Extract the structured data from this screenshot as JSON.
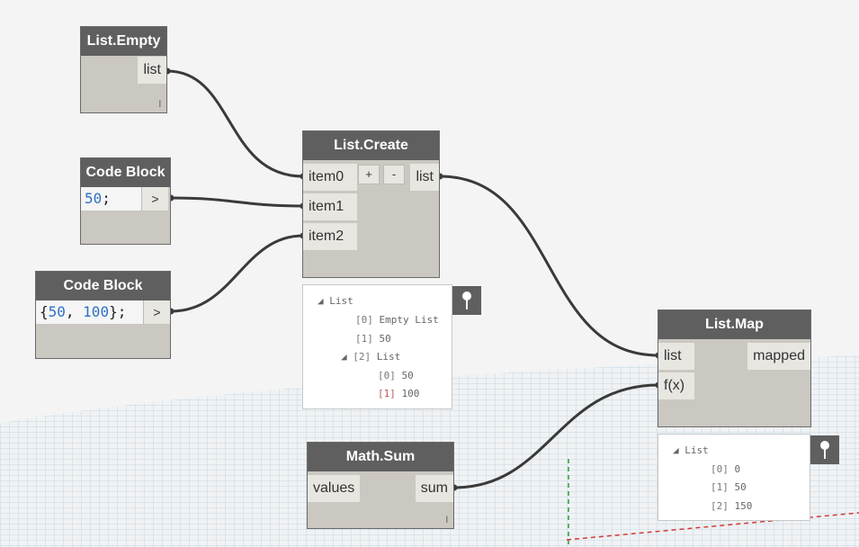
{
  "nodes": {
    "list_empty": {
      "title": "List.Empty",
      "output": "list",
      "lacing": "l"
    },
    "code_block_1": {
      "title": "Code Block",
      "code": "50;",
      "code_num": "50",
      "code_rest": ";",
      "output": ">"
    },
    "code_block_2": {
      "title": "Code Block",
      "code_open": "{",
      "num1": "50",
      "sep": ", ",
      "num2": "100",
      "code_close": "};",
      "output": ">"
    },
    "list_create": {
      "title": "List.Create",
      "inputs": [
        "item0",
        "item1",
        "item2"
      ],
      "add": "+",
      "remove": "-",
      "output": "list"
    },
    "list_map": {
      "title": "List.Map",
      "inputs": [
        "list",
        "f(x)"
      ],
      "output": "mapped"
    },
    "math_sum": {
      "title": "Math.Sum",
      "input": "values",
      "output": "sum",
      "lacing": "l"
    }
  },
  "previews": {
    "list_create": {
      "root": "List",
      "items": [
        {
          "index": "[0]",
          "value": "Empty List"
        },
        {
          "index": "[1]",
          "value": "50"
        },
        {
          "index": "[2]",
          "value": "List"
        }
      ],
      "sub_items": [
        {
          "index": "[0]",
          "value": "50"
        },
        {
          "index": "[1]",
          "value": "100"
        }
      ]
    },
    "list_map": {
      "root": "List",
      "items": [
        {
          "index": "[0]",
          "value": "0"
        },
        {
          "index": "[1]",
          "value": "50"
        },
        {
          "index": "[2]",
          "value": "150"
        }
      ]
    }
  },
  "colors": {
    "header": "#5f5f5f",
    "wire": "#3a3a3a",
    "number": "#2f6fc4",
    "grid": "#9fc1d6"
  }
}
